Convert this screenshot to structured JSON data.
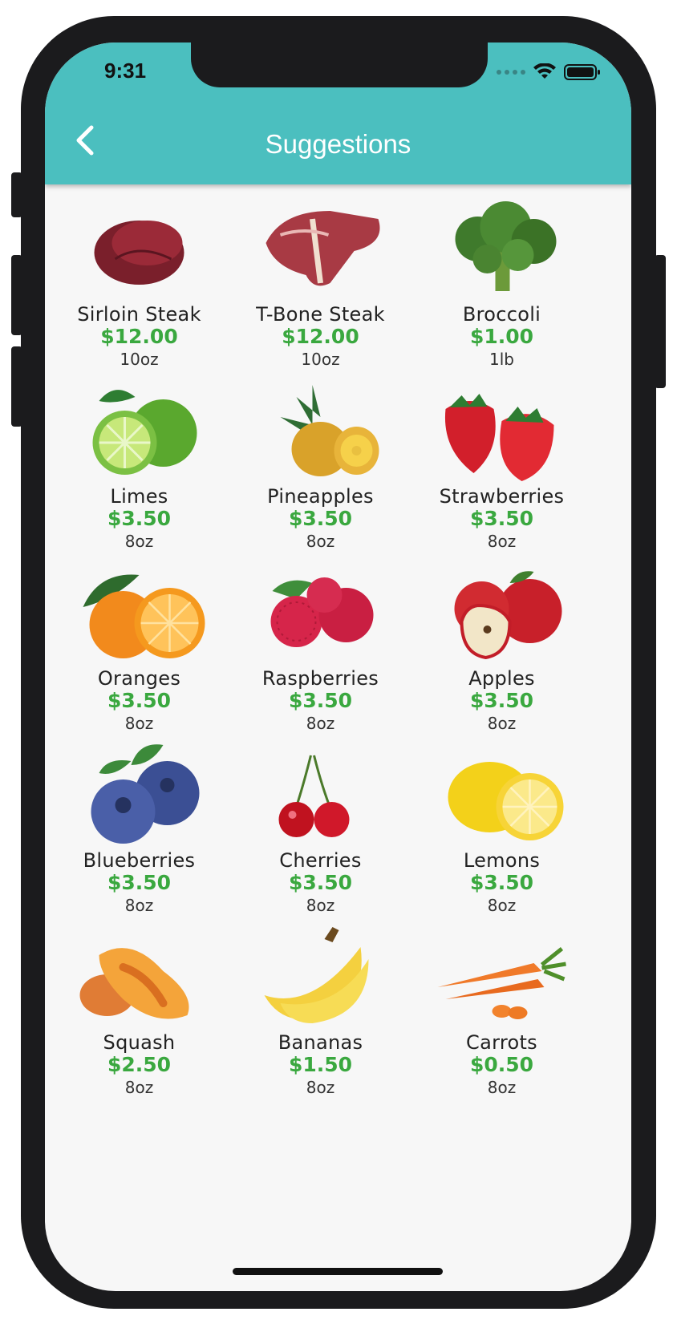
{
  "status": {
    "time": "9:31"
  },
  "header": {
    "title": "Suggestions",
    "back_icon": "chevron-left-icon"
  },
  "colors": {
    "header": "#4bbfbf",
    "price": "#3aa83f",
    "background": "#f7f7f7"
  },
  "products": [
    {
      "name": "Sirloin Steak",
      "price": "$12.00",
      "unit": "10oz",
      "icon": "steak-icon"
    },
    {
      "name": "T-Bone Steak",
      "price": "$12.00",
      "unit": "10oz",
      "icon": "tbone-icon"
    },
    {
      "name": "Broccoli",
      "price": "$1.00",
      "unit": "1lb",
      "icon": "broccoli-icon"
    },
    {
      "name": "Limes",
      "price": "$3.50",
      "unit": "8oz",
      "icon": "lime-icon"
    },
    {
      "name": "Pineapples",
      "price": "$3.50",
      "unit": "8oz",
      "icon": "pineapple-icon"
    },
    {
      "name": "Strawberries",
      "price": "$3.50",
      "unit": "8oz",
      "icon": "strawberry-icon"
    },
    {
      "name": "Oranges",
      "price": "$3.50",
      "unit": "8oz",
      "icon": "orange-icon"
    },
    {
      "name": "Raspberries",
      "price": "$3.50",
      "unit": "8oz",
      "icon": "raspberry-icon"
    },
    {
      "name": "Apples",
      "price": "$3.50",
      "unit": "8oz",
      "icon": "apple-icon"
    },
    {
      "name": "Blueberries",
      "price": "$3.50",
      "unit": "8oz",
      "icon": "blueberry-icon"
    },
    {
      "name": "Cherries",
      "price": "$3.50",
      "unit": "8oz",
      "icon": "cherry-icon"
    },
    {
      "name": "Lemons",
      "price": "$3.50",
      "unit": "8oz",
      "icon": "lemon-icon"
    },
    {
      "name": "Squash",
      "price": "$2.50",
      "unit": "8oz",
      "icon": "squash-icon"
    },
    {
      "name": "Bananas",
      "price": "$1.50",
      "unit": "8oz",
      "icon": "banana-icon"
    },
    {
      "name": "Carrots",
      "price": "$0.50",
      "unit": "8oz",
      "icon": "carrot-icon"
    }
  ]
}
